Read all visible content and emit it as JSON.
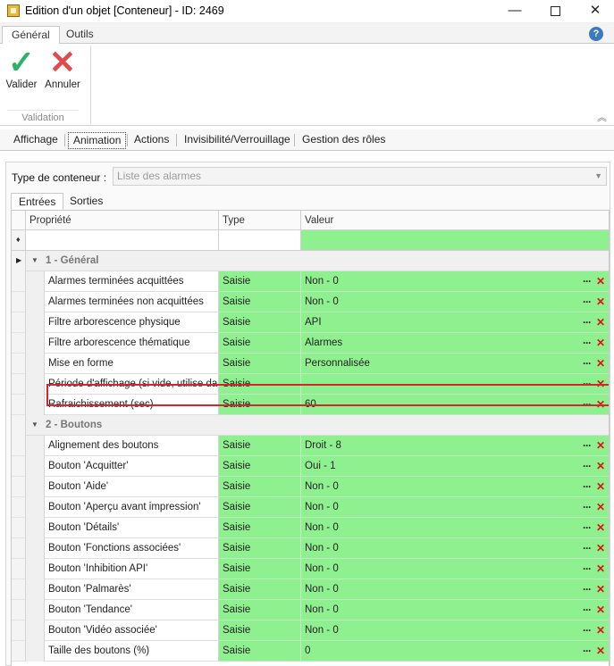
{
  "window": {
    "title": "Edition d'un objet [Conteneur] - ID: 2469",
    "minimize": "—",
    "close": "✕"
  },
  "ribbon_tabs": [
    "Général",
    "Outils"
  ],
  "help_glyph": "?",
  "ribbon": {
    "validate_label": "Valider",
    "cancel_label": "Annuler",
    "group_label": "Validation",
    "collapse_glyph": "︽"
  },
  "main_tabs": [
    "Affichage",
    "Animation",
    "Actions",
    "Invisibilité/Verrouillage",
    "Gestion des rôles"
  ],
  "container": {
    "label": "Type de conteneur :",
    "value": "Liste des alarmes"
  },
  "sub_tabs": [
    "Entrées",
    "Sorties"
  ],
  "grid": {
    "headers": [
      "Propriété",
      "Type",
      "Valeur"
    ],
    "groups": [
      {
        "title": "1 - Général",
        "rows": [
          {
            "prop": "Alarmes terminées acquittées",
            "type": "Saisie",
            "value": "Non - 0"
          },
          {
            "prop": "Alarmes terminées non acquittées",
            "type": "Saisie",
            "value": "Non - 0"
          },
          {
            "prop": "Filtre arborescence physique",
            "type": "Saisie",
            "value": "API"
          },
          {
            "prop": "Filtre arborescence thématique",
            "type": "Saisie",
            "value": "Alarmes"
          },
          {
            "prop": "Mise en forme",
            "type": "Saisie",
            "value": "Personnalisée"
          },
          {
            "prop": "Période d'affichage (si vide, utilise da...",
            "type": "Saisie",
            "value": ""
          },
          {
            "prop": "Rafraichissement (sec)",
            "type": "Saisie",
            "value": "60"
          }
        ]
      },
      {
        "title": "2 - Boutons",
        "rows": [
          {
            "prop": "Alignement des boutons",
            "type": "Saisie",
            "value": "Droit - 8"
          },
          {
            "prop": "Bouton 'Acquitter'",
            "type": "Saisie",
            "value": "Oui - 1"
          },
          {
            "prop": "Bouton 'Aide'",
            "type": "Saisie",
            "value": "Non - 0"
          },
          {
            "prop": "Bouton 'Aperçu avant impression'",
            "type": "Saisie",
            "value": "Non - 0"
          },
          {
            "prop": "Bouton 'Détails'",
            "type": "Saisie",
            "value": "Non - 0"
          },
          {
            "prop": "Bouton 'Fonctions associées'",
            "type": "Saisie",
            "value": "Non - 0"
          },
          {
            "prop": "Bouton 'Inhibition API'",
            "type": "Saisie",
            "value": "Non - 0"
          },
          {
            "prop": "Bouton 'Palmarès'",
            "type": "Saisie",
            "value": "Non - 0"
          },
          {
            "prop": "Bouton 'Tendance'",
            "type": "Saisie",
            "value": "Non - 0"
          },
          {
            "prop": "Bouton 'Vidéo associée'",
            "type": "Saisie",
            "value": "Non - 0"
          },
          {
            "prop": "Taille des boutons (%)",
            "type": "Saisie",
            "value": "0"
          }
        ]
      }
    ],
    "ellipsis": "···",
    "delete": "✕"
  },
  "colors": {
    "grid_green": "#8ff08f",
    "highlight_red": "#d9232d",
    "check_green": "#2bb36b",
    "cancel_red": "#e2494c"
  }
}
